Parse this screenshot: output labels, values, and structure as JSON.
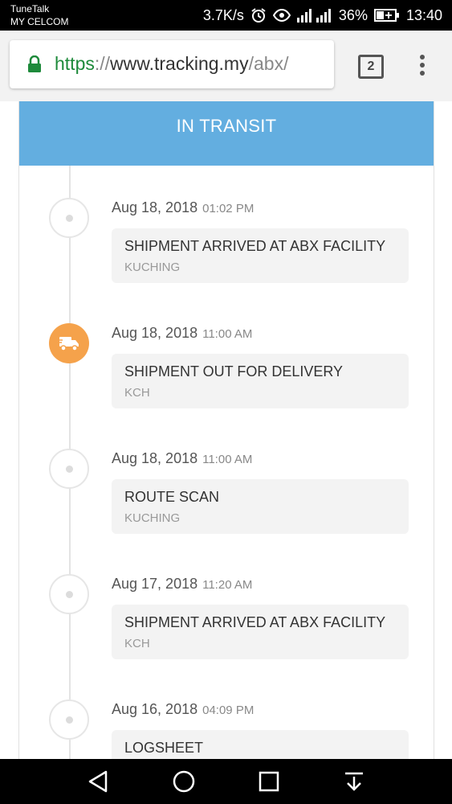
{
  "status_bar": {
    "carrier_line1": "TuneTalk",
    "carrier_line2": "MY CELCOM",
    "speed": "3.7K/s",
    "battery": "36%",
    "time": "13:40"
  },
  "browser": {
    "url_scheme": "https",
    "url_sep": "://",
    "url_host": "www.tracking.my",
    "url_path": "/abx/",
    "tab_count": "2"
  },
  "tracking": {
    "status": "IN TRANSIT",
    "events": [
      {
        "date": "Aug 18, 2018",
        "time": "01:02 PM",
        "title": "SHIPMENT ARRIVED AT ABX FACILITY",
        "location": "KUCHING"
      },
      {
        "date": "Aug 18, 2018",
        "time": "11:00 AM",
        "title": "SHIPMENT OUT FOR DELIVERY",
        "location": "KCH"
      },
      {
        "date": "Aug 18, 2018",
        "time": "11:00 AM",
        "title": "ROUTE SCAN",
        "location": "KUCHING"
      },
      {
        "date": "Aug 17, 2018",
        "time": "11:20 AM",
        "title": "SHIPMENT ARRIVED AT ABX FACILITY",
        "location": "KCH"
      },
      {
        "date": "Aug 16, 2018",
        "time": "04:09 PM",
        "title": "LOGSHEET",
        "location": ""
      }
    ]
  },
  "colors": {
    "banner": "#63aee0",
    "active_node": "#f5a24b",
    "secure": "#1e8a3b"
  },
  "icons": {
    "lock": "lock-icon",
    "truck": "delivery-truck-icon",
    "back": "back-triangle-icon",
    "home": "home-circle-icon",
    "recents": "recents-square-icon",
    "notifications": "pull-down-icon"
  }
}
